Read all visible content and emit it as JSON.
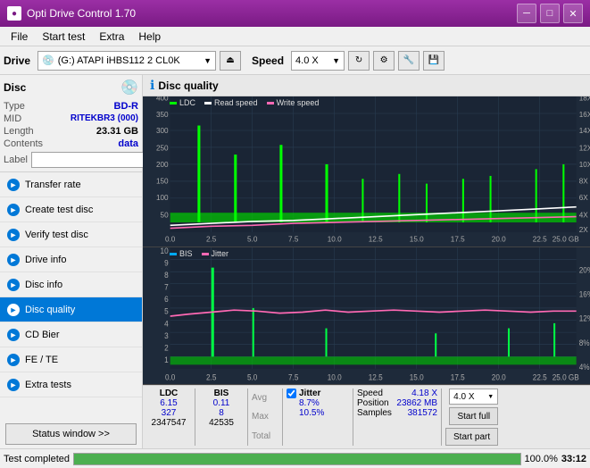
{
  "window": {
    "title": "Opti Drive Control 1.70",
    "icon": "●"
  },
  "title_controls": {
    "minimize": "─",
    "maximize": "□",
    "close": "✕"
  },
  "menu": {
    "items": [
      "File",
      "Start test",
      "Extra",
      "Help"
    ]
  },
  "toolbar": {
    "drive_label": "Drive",
    "drive_value": "(G:) ATAPI iHBS112  2 CL0K",
    "speed_label": "Speed",
    "speed_value": "4.0 X"
  },
  "disc": {
    "title": "Disc",
    "type_label": "Type",
    "type_value": "BD-R",
    "mid_label": "MID",
    "mid_value": "RITEKBR3 (000)",
    "length_label": "Length",
    "length_value": "23.31 GB",
    "contents_label": "Contents",
    "contents_value": "data",
    "label_label": "Label",
    "label_value": ""
  },
  "nav": {
    "items": [
      {
        "id": "transfer-rate",
        "label": "Transfer rate",
        "icon": "►",
        "active": false
      },
      {
        "id": "create-test-disc",
        "label": "Create test disc",
        "icon": "►",
        "active": false
      },
      {
        "id": "verify-test-disc",
        "label": "Verify test disc",
        "icon": "►",
        "active": false
      },
      {
        "id": "drive-info",
        "label": "Drive info",
        "icon": "►",
        "active": false
      },
      {
        "id": "disc-info",
        "label": "Disc info",
        "icon": "►",
        "active": false
      },
      {
        "id": "disc-quality",
        "label": "Disc quality",
        "icon": "►",
        "active": true
      },
      {
        "id": "cd-bier",
        "label": "CD Bier",
        "icon": "►",
        "active": false
      },
      {
        "id": "fe-te",
        "label": "FE / TE",
        "icon": "►",
        "active": false
      },
      {
        "id": "extra-tests",
        "label": "Extra tests",
        "icon": "►",
        "active": false
      }
    ]
  },
  "status_btn": "Status window >>",
  "chart": {
    "title": "Disc quality",
    "legend1": {
      "ldc": "LDC",
      "read_speed": "Read speed",
      "write_speed": "Write speed"
    },
    "legend2": {
      "bis": "BIS",
      "jitter": "Jitter"
    },
    "top_y_labels": [
      "400",
      "350",
      "300",
      "250",
      "200",
      "150",
      "100",
      "50"
    ],
    "top_y_right": [
      "18X",
      "16X",
      "14X",
      "12X",
      "10X",
      "8X",
      "6X",
      "4X",
      "2X"
    ],
    "bot_y_labels": [
      "10",
      "9",
      "8",
      "7",
      "6",
      "5",
      "4",
      "3",
      "2",
      "1"
    ],
    "bot_y_right": [
      "20%",
      "16%",
      "12%",
      "8%",
      "4%"
    ],
    "x_labels": [
      "0.0",
      "2.5",
      "5.0",
      "7.5",
      "10.0",
      "12.5",
      "15.0",
      "17.5",
      "20.0",
      "22.5",
      "25.0 GB"
    ]
  },
  "stats": {
    "avg_label": "Avg",
    "max_label": "Max",
    "total_label": "Total",
    "ldc_avg": "6.15",
    "ldc_max": "327",
    "ldc_total": "2347547",
    "bis_avg": "0.11",
    "bis_max": "8",
    "bis_total": "42535",
    "jitter_label": "Jitter",
    "jitter_avg": "8.7%",
    "jitter_max": "10.5%",
    "speed_label": "Speed",
    "speed_value": "4.18 X",
    "speed_setting": "4.0 X",
    "position_label": "Position",
    "position_value": "23862 MB",
    "samples_label": "Samples",
    "samples_value": "381572",
    "start_full": "Start full",
    "start_part": "Start part"
  },
  "bottom": {
    "status_text": "Test completed",
    "progress": 100,
    "time": "33:12"
  },
  "colors": {
    "ldc": "#00ff00",
    "read_speed": "#ffffff",
    "write_speed": "#ff69b4",
    "bis": "#00aaff",
    "jitter": "#ff69b4",
    "grid": "#2a3f55",
    "chart_bg": "#1e2d3e",
    "accent_blue": "#0078d7",
    "active_nav": "#0078d7"
  }
}
